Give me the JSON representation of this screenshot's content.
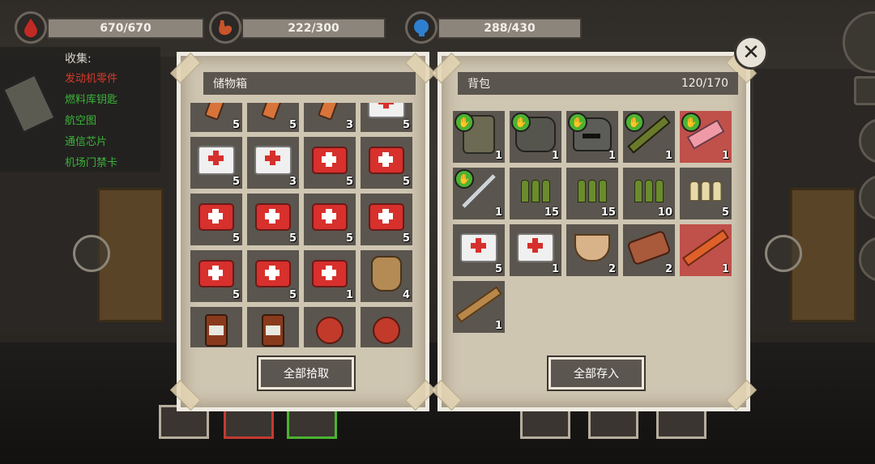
{
  "status": {
    "hp": {
      "text": "670/670",
      "icon": "blood-drop-icon",
      "color": "#c22a24"
    },
    "food": {
      "text": "222/300",
      "icon": "stomach-icon",
      "color": "#c8542c"
    },
    "water": {
      "text": "288/430",
      "icon": "head-water-icon",
      "color": "#2f7fd0"
    }
  },
  "collection": {
    "title": "收集:",
    "items": [
      {
        "label": "发动机零件",
        "color": "#d83a2a"
      },
      {
        "label": "燃料库钥匙",
        "color": "#3cb43c"
      },
      {
        "label": "航空图",
        "color": "#3cb43c"
      },
      {
        "label": "通信芯片",
        "color": "#3cb43c"
      },
      {
        "label": "机场门禁卡",
        "color": "#3cb43c"
      }
    ]
  },
  "storage": {
    "title": "储物箱",
    "button": "全部拾取",
    "items": [
      {
        "type": "vial",
        "count": "5"
      },
      {
        "type": "vial",
        "count": "5"
      },
      {
        "type": "vial",
        "count": "3"
      },
      {
        "type": "firstaid",
        "count": "5"
      },
      {
        "type": "firstaid",
        "count": "5"
      },
      {
        "type": "firstaid",
        "count": "3"
      },
      {
        "type": "medkit",
        "count": "5"
      },
      {
        "type": "medkit",
        "count": "5"
      },
      {
        "type": "medkit",
        "count": "5"
      },
      {
        "type": "medkit",
        "count": "5"
      },
      {
        "type": "medkit",
        "count": "5"
      },
      {
        "type": "medkit",
        "count": "5"
      },
      {
        "type": "medkit",
        "count": "5"
      },
      {
        "type": "medkit",
        "count": "5"
      },
      {
        "type": "medkit",
        "count": "1"
      },
      {
        "type": "sack",
        "count": "4"
      },
      {
        "type": "bottle",
        "count": ""
      },
      {
        "type": "bottle",
        "count": ""
      },
      {
        "type": "apple",
        "count": ""
      },
      {
        "type": "apple",
        "count": ""
      }
    ]
  },
  "backpack": {
    "title": "背包",
    "capacity": "120/170",
    "button": "全部存入",
    "items": [
      {
        "type": "armor",
        "count": "1",
        "equipped": true
      },
      {
        "type": "mine",
        "count": "1",
        "equipped": true
      },
      {
        "type": "helmet",
        "count": "1",
        "equipped": true
      },
      {
        "type": "rifle",
        "count": "1",
        "equipped": true
      },
      {
        "type": "pistol",
        "count": "1",
        "equipped": true,
        "red": true
      },
      {
        "type": "katana",
        "count": "1",
        "equipped": true
      },
      {
        "type": "ammo-g",
        "count": "15"
      },
      {
        "type": "ammo-g",
        "count": "15"
      },
      {
        "type": "ammo-g",
        "count": "10"
      },
      {
        "type": "ammo-s",
        "count": "5"
      },
      {
        "type": "firstaid",
        "count": "5"
      },
      {
        "type": "firstaid",
        "count": "1"
      },
      {
        "type": "bowl",
        "count": "2"
      },
      {
        "type": "skewer",
        "count": "2"
      },
      {
        "type": "pipe",
        "count": "1",
        "red": true
      },
      {
        "type": "stick",
        "count": "1"
      }
    ]
  },
  "close_icon": "close-icon"
}
